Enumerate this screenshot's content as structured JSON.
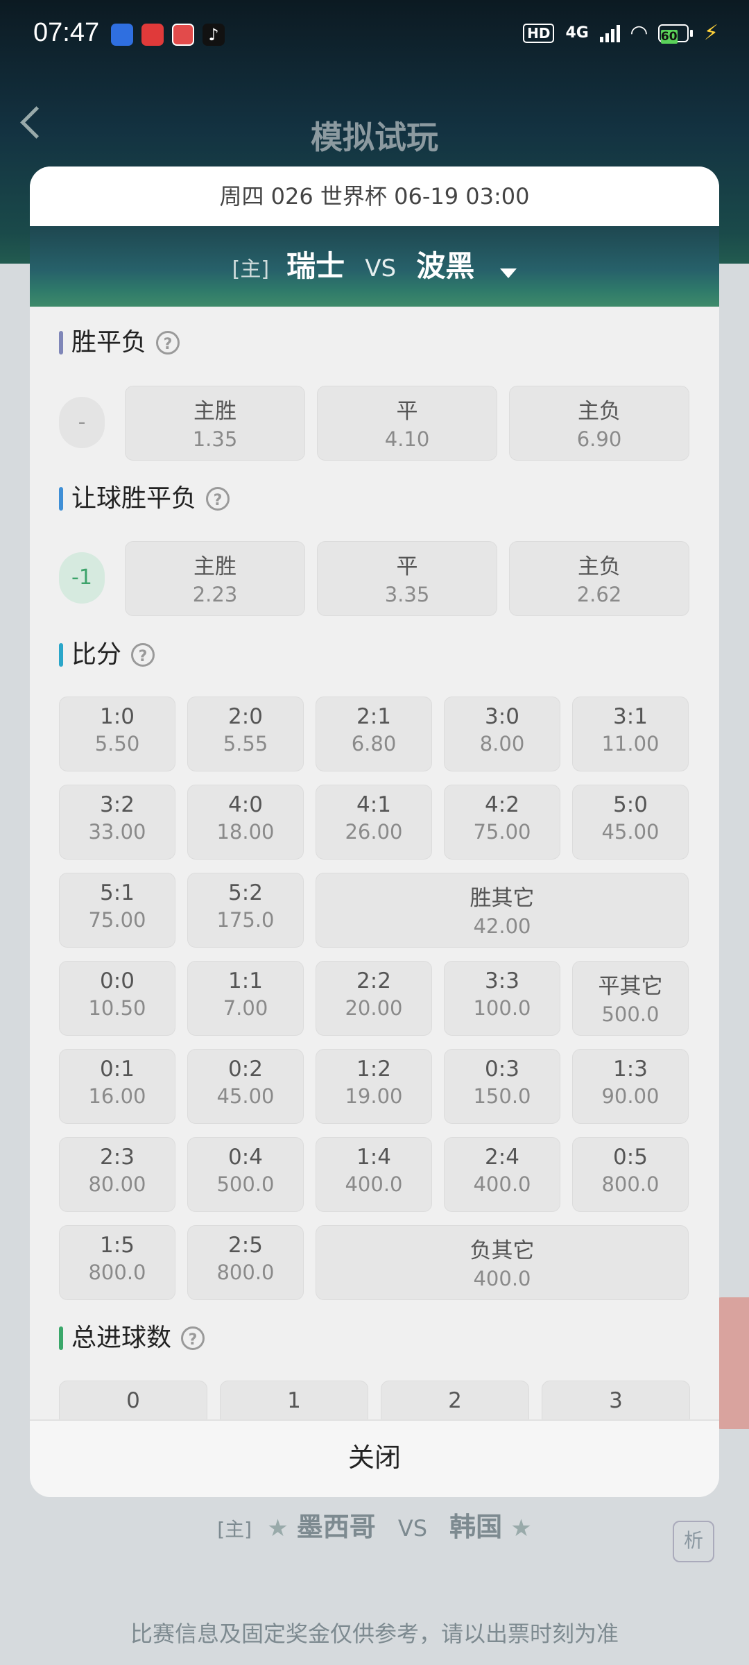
{
  "status_bar": {
    "time": "07:47",
    "hd": "HD",
    "network": "4G",
    "battery": "60",
    "app_icons": [
      "app-icon-blue",
      "app-icon-red",
      "app-icon-news",
      "tiktok-icon"
    ]
  },
  "background": {
    "title": "模拟试玩",
    "match": {
      "home_tag": "[主]",
      "home": "墨西哥",
      "vs": "VS",
      "away": "韩国"
    },
    "analyze": "析",
    "note": "比赛信息及固定奖金仅供参考，请以出票时刻为准"
  },
  "modal": {
    "header": "周四 026 世界杯 06-19 03:00",
    "match": {
      "home_tag": "[主]",
      "home": "瑞士",
      "vs": "VS",
      "away": "波黑"
    },
    "close_label": "关闭",
    "sections": {
      "wdl": {
        "title": "胜平负",
        "handicap": "-",
        "options": [
          {
            "label": "主胜",
            "odds": "1.35"
          },
          {
            "label": "平",
            "odds": "4.10"
          },
          {
            "label": "主负",
            "odds": "6.90"
          }
        ]
      },
      "hwdl": {
        "title": "让球胜平负",
        "handicap": "-1",
        "options": [
          {
            "label": "主胜",
            "odds": "2.23"
          },
          {
            "label": "平",
            "odds": "3.35"
          },
          {
            "label": "主负",
            "odds": "2.62"
          }
        ]
      },
      "score": {
        "title": "比分",
        "rows": [
          [
            {
              "label": "1:0",
              "odds": "5.50"
            },
            {
              "label": "2:0",
              "odds": "5.55"
            },
            {
              "label": "2:1",
              "odds": "6.80"
            },
            {
              "label": "3:0",
              "odds": "8.00"
            },
            {
              "label": "3:1",
              "odds": "11.00"
            }
          ],
          [
            {
              "label": "3:2",
              "odds": "33.00"
            },
            {
              "label": "4:0",
              "odds": "18.00"
            },
            {
              "label": "4:1",
              "odds": "26.00"
            },
            {
              "label": "4:2",
              "odds": "75.00"
            },
            {
              "label": "5:0",
              "odds": "45.00"
            }
          ],
          [
            {
              "label": "5:1",
              "odds": "75.00"
            },
            {
              "label": "5:2",
              "odds": "175.0"
            },
            {
              "label": "胜其它",
              "odds": "42.00"
            }
          ],
          [
            {
              "label": "0:0",
              "odds": "10.50"
            },
            {
              "label": "1:1",
              "odds": "7.00"
            },
            {
              "label": "2:2",
              "odds": "20.00"
            },
            {
              "label": "3:3",
              "odds": "100.0"
            },
            {
              "label": "平其它",
              "odds": "500.0"
            }
          ],
          [
            {
              "label": "0:1",
              "odds": "16.00"
            },
            {
              "label": "0:2",
              "odds": "45.00"
            },
            {
              "label": "1:2",
              "odds": "19.00"
            },
            {
              "label": "0:3",
              "odds": "150.0"
            },
            {
              "label": "1:3",
              "odds": "90.00"
            }
          ],
          [
            {
              "label": "2:3",
              "odds": "80.00"
            },
            {
              "label": "0:4",
              "odds": "500.0"
            },
            {
              "label": "1:4",
              "odds": "400.0"
            },
            {
              "label": "2:4",
              "odds": "400.0"
            },
            {
              "label": "0:5",
              "odds": "800.0"
            }
          ],
          [
            {
              "label": "1:5",
              "odds": "800.0"
            },
            {
              "label": "2:5",
              "odds": "800.0"
            },
            {
              "label": "负其它",
              "odds": "400.0"
            }
          ]
        ]
      },
      "total_goals": {
        "title": "总进球数",
        "options": [
          "0",
          "1",
          "2",
          "3"
        ]
      }
    }
  },
  "colors": {
    "bar_wdl": "#7f86b8",
    "bar_hwdl": "#3f8fd6",
    "bar_score": "#2aa6c9",
    "bar_goals": "#3aa76a",
    "handicap_green": "#3ca36a"
  }
}
